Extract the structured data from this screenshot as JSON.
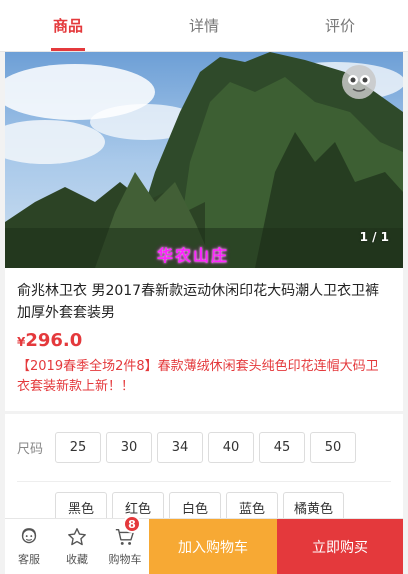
{
  "tabs": [
    {
      "label": "商品",
      "active": true
    },
    {
      "label": "详情",
      "active": false
    },
    {
      "label": "评价",
      "active": false
    }
  ],
  "gallery": {
    "overlay_text": "华农山庄",
    "counter": "1 / 1",
    "watermark_icon": "face-logo-icon"
  },
  "product": {
    "title": "俞兆林卫衣 男2017春新款运动休闲印花大码潮人卫衣卫裤加厚外套套装男",
    "price_symbol": "¥",
    "price": "296.0",
    "promo": "【2019春季全场2件8】春款薄绒休闲套头纯色印花连帽大码卫衣套装新款上新！！"
  },
  "options": {
    "size_label": "尺码",
    "sizes": [
      "25",
      "30",
      "34",
      "40",
      "45",
      "50"
    ],
    "colors": [
      "黑色",
      "红色",
      "白色",
      "蓝色",
      "橘黄色"
    ]
  },
  "bottom_bar": {
    "service_label": "客服",
    "favorite_label": "收藏",
    "cart_label": "购物车",
    "cart_count": "8",
    "add_to_cart": "加入购物车",
    "buy_now": "立即购买"
  },
  "colors": {
    "accent": "#e4393c",
    "cart_button": "#f7a934",
    "overlay_text": "#ff22ff"
  }
}
